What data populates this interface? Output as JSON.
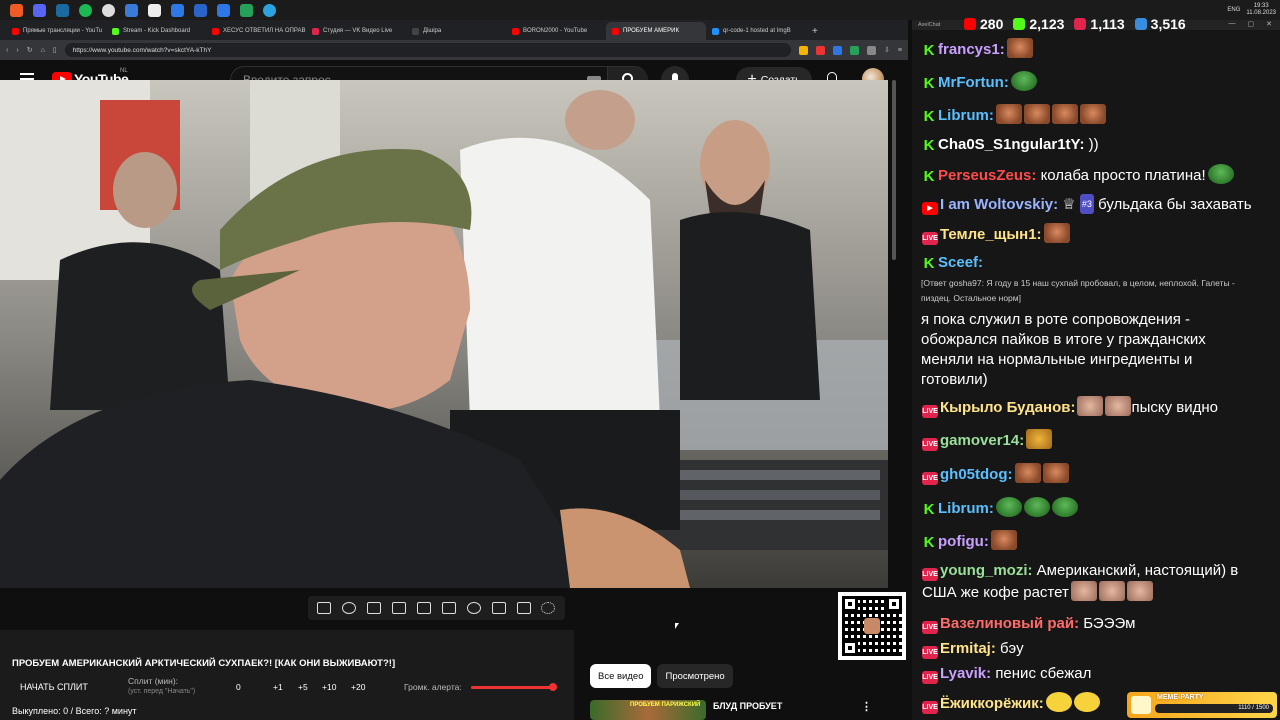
{
  "taskbar": {
    "icons": [
      "brave-icon",
      "discord-icon",
      "steam-icon",
      "spotify-icon",
      "obs-icon",
      "app-icon",
      "game-icon",
      "app-icon-2",
      "app-icon-3",
      "app-icon-4",
      "app-icon-5",
      "telegram-icon"
    ],
    "lang": "ENG",
    "time": "19:33",
    "date": "11.08.2023"
  },
  "browser": {
    "tabs": [
      {
        "label": "Прямые трансляции - YouTu",
        "color": "#ff0000"
      },
      {
        "label": "Stream - Kick Dashboard",
        "color": "#53fc18"
      },
      {
        "label": "ХЕСУС ОТВЕТИЛ НА ОПРАВ",
        "color": "#ff0000"
      },
      {
        "label": "Студия — VK Видео Live",
        "color": "#e0244c"
      },
      {
        "label": "Дішіра",
        "color": "#444444"
      },
      {
        "label": "BORON2000 - YouTube",
        "color": "#ff0000"
      },
      {
        "label": "ПРОБУЕМ АМЕРИК",
        "color": "#ff0000",
        "active": true
      },
      {
        "label": "qr-code-1 hosted at ImgB",
        "color": "#1e90ff"
      }
    ],
    "url": "https://www.youtube.com/watch?v=skctYA-kThY"
  },
  "youtube": {
    "logo": "YouTube",
    "region": "NL",
    "search_placeholder": "Введите запрос",
    "create_label": "Создать"
  },
  "player_controls": [
    "loop-icon",
    "broadcast-icon",
    "screen-record-icon",
    "clip-icon",
    "cinema-icon",
    "frames-icon",
    "speed-icon",
    "add-icon",
    "screenshot-icon",
    "settings-icon"
  ],
  "panel": {
    "title": "ПРОБУЕМ АМЕРИКАНСКИЙ АРКТИЧЕСКИЙ СУХПАЕК?! [КАК ОНИ ВЫЖИВАЮТ?!]",
    "split_button": "НАЧАТЬ СПЛИТ",
    "split_label": "Сплит (мин):",
    "split_sub": "(уст. перед \"Начать\")",
    "split_values": [
      "0",
      "+1",
      "+5",
      "+10",
      "+20"
    ],
    "volume_label": "Громк. алерта:",
    "volume": 0.95,
    "bought": "Выкуплено: 0 / Всего: ? минут"
  },
  "video_tabs": [
    {
      "label": "Все видео",
      "active": true
    },
    {
      "label": "Просмотрено",
      "active": false
    }
  ],
  "recommendation": {
    "thumb_text": "ПРОБУЕМ ПАРИЖСКИЙ",
    "title": "БЛУД ПРОБУЕТ"
  },
  "chat": {
    "app_name": "AxelChat",
    "stats": [
      {
        "platform": "youtube",
        "value": "280",
        "color": "#ff0000"
      },
      {
        "platform": "kick",
        "value": "2,123",
        "color": "#53fc18"
      },
      {
        "platform": "vk",
        "value": "1,113",
        "color": "#e0244c"
      },
      {
        "platform": "twitch",
        "value": "3,516",
        "color": "#3a8dde"
      }
    ],
    "messages": [
      {
        "platform": "kick",
        "nick": "francys1:",
        "color": "#c9a0ff",
        "text": ""
      },
      {
        "platform": "kick",
        "nick": "MrFortun:",
        "color": "#5bc0ff",
        "text": ""
      },
      {
        "platform": "kick",
        "nick": "Librum:",
        "color": "#5bc0ff",
        "text": ""
      },
      {
        "platform": "kick",
        "nick": "Cha0S_S1ngular1tY:",
        "color": "#ffffff",
        "text": "))"
      },
      {
        "platform": "kick",
        "nick": "PerseusZeus:",
        "color": "#ff4b4b",
        "text": "колаба просто платина!"
      },
      {
        "platform": "youtube",
        "nick": "I am Woltovskiy:",
        "color": "#9ab4ff",
        "text": "бульдака бы захавать",
        "rank": "#3"
      },
      {
        "platform": "vk",
        "nick": "Темле_щын1:",
        "color": "#ffe38a",
        "text": ""
      },
      {
        "platform": "kick",
        "nick": "Sceef:",
        "color": "#5bc0ff",
        "text": ""
      },
      {
        "platform": "vk",
        "nick": "Кырыло Буданов:",
        "color": "#ffe38a",
        "text": "пыску видно"
      },
      {
        "platform": "vk",
        "nick": "gamover14:",
        "color": "#9adf9a",
        "text": ""
      },
      {
        "platform": "vk",
        "nick": "gh05tdog:",
        "color": "#5bc0ff",
        "text": ""
      },
      {
        "platform": "kick",
        "nick": "Librum:",
        "color": "#5bc0ff",
        "text": ""
      },
      {
        "platform": "kick",
        "nick": "pofigu:",
        "color": "#c9a0ff",
        "text": ""
      },
      {
        "platform": "vk",
        "nick": "young_mozi:",
        "color": "#9adf9a",
        "text": "Американский, настоящий) в США же кофе растет"
      },
      {
        "platform": "vk",
        "nick": "Вазелиновый рай:",
        "color": "#ff6b6b",
        "text": "БЭЭЭм"
      },
      {
        "platform": "vk",
        "nick": "Ermitaj:",
        "color": "#ffe38a",
        "text": "бэу"
      },
      {
        "platform": "vk",
        "nick": "Lyavik:",
        "color": "#c9a0ff",
        "text": "пенис сбежал"
      },
      {
        "platform": "vk",
        "nick": "Ёжиккорёжик:",
        "color": "#ffe38a",
        "text": ""
      }
    ],
    "sceef_reply": "[Ответ gosha97: Я году в 15 наш сухпай пробовал, в целом, неплохой. Галеты - пиздец. Остальное норм]",
    "sceef_text": "я пока служил в роте сопровождения - обожрался пайков в итоге у гражданских меняли на нормальные ингредиенты и готовили)",
    "meme_party": {
      "label": "MEME-PARTY",
      "progress": "1110 / 1500"
    }
  },
  "accent_colors": {
    "youtube_red": "#ff0000",
    "kick_green": "#53fc18",
    "vk_red": "#e0244c"
  }
}
